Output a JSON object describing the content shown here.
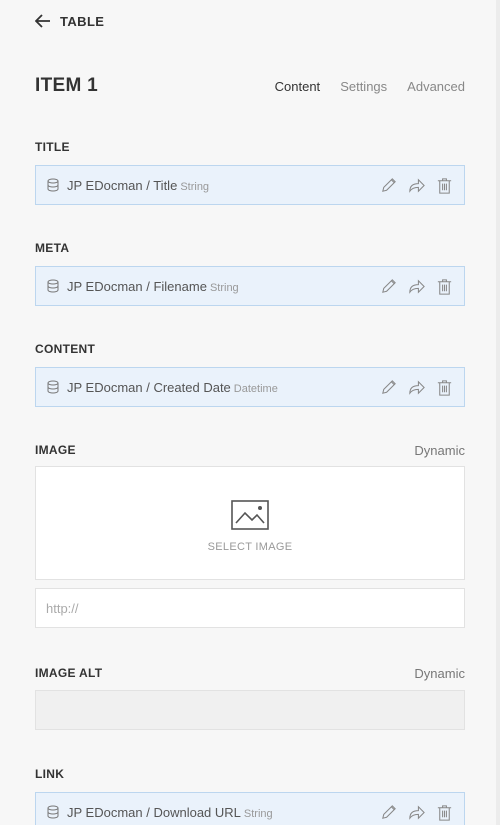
{
  "back": {
    "label": "TABLE"
  },
  "page": {
    "title": "ITEM 1"
  },
  "tabs": [
    {
      "label": "Content",
      "active": true
    },
    {
      "label": "Settings",
      "active": false
    },
    {
      "label": "Advanced",
      "active": false
    }
  ],
  "fields": {
    "title": {
      "label": "TITLE",
      "source": "JP EDocman / Title",
      "type": "String"
    },
    "meta": {
      "label": "META",
      "source": "JP EDocman / Filename",
      "type": "String"
    },
    "content": {
      "label": "CONTENT",
      "source": "JP EDocman / Created Date",
      "type": "Datetime"
    },
    "image": {
      "label": "IMAGE",
      "mode": "Dynamic",
      "select_label": "SELECT IMAGE",
      "url_placeholder": "http://"
    },
    "image_alt": {
      "label": "IMAGE ALT",
      "mode": "Dynamic",
      "value": ""
    },
    "link": {
      "label": "LINK",
      "source": "JP EDocman / Download URL",
      "type": "String"
    }
  },
  "colors": {
    "source_bg": "#eaf2fb",
    "source_border": "#bcd6ef",
    "background": "#f7f7f7"
  },
  "icons": [
    "arrow-left-icon",
    "database-icon",
    "pencil-icon",
    "share-icon",
    "trash-icon",
    "image-icon"
  ]
}
